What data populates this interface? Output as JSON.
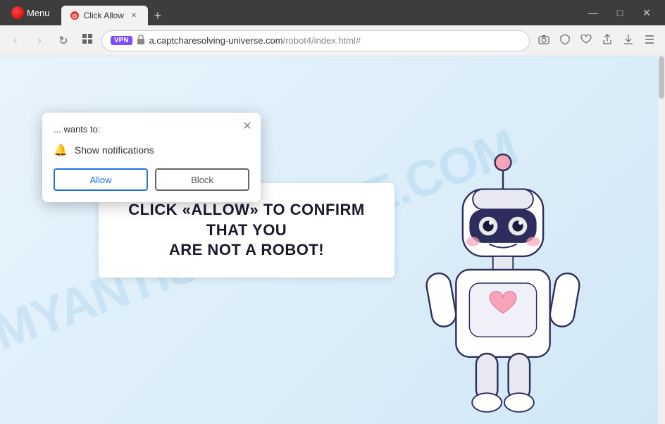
{
  "titlebar": {
    "opera_label": "Menu",
    "tab_active_label": "Click Allow",
    "new_tab_btn": "+",
    "minimize_icon": "—",
    "maximize_icon": "□",
    "close_icon": "✕"
  },
  "addressbar": {
    "back_btn": "‹",
    "forward_btn": "›",
    "reload_btn": "↻",
    "grid_btn": "⊞",
    "vpn_label": "VPN",
    "url_domain": "a.captcharesolving-universe.com",
    "url_path": "/robot4/index.html#",
    "cam_icon": "📷",
    "shield_icon": "🛡",
    "heart_icon": "♡",
    "share_icon": "⬆",
    "download_icon": "⬇",
    "menu_icon": "≡"
  },
  "notification_popup": {
    "wants_to_text": "... wants to:",
    "close_btn": "✕",
    "notification_label": "Show notifications",
    "allow_btn": "Allow",
    "block_btn": "Block"
  },
  "captcha_box": {
    "line1": "CLICK «ALLOW» TO CONFIRM THAT YOU",
    "line2": "ARE NOT A ROBOT!"
  },
  "watermark": {
    "text": "MYANTISPYWARE.COM"
  },
  "colors": {
    "allow_btn_color": "#1a73e8",
    "block_btn_color": "#666666",
    "captcha_text_color": "#1a1a2e",
    "bg_gradient_start": "#e8f4fd",
    "bg_gradient_end": "#d0e8f5"
  }
}
